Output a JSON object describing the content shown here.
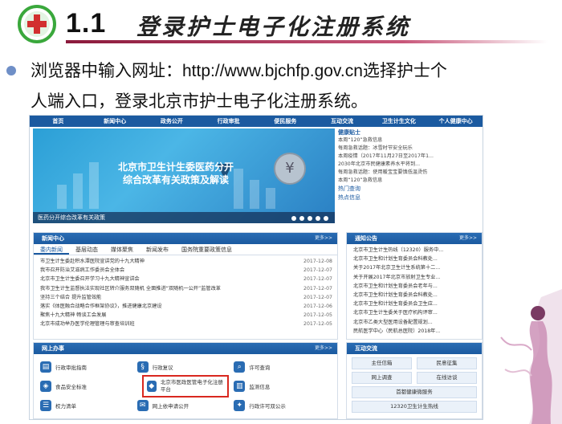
{
  "slide": {
    "title_number": "1.1",
    "title_text": "登录护士电子化注册系统",
    "bullet_line1": "浏览器中输入网址：http://www.bjchfp.gov.cn选择护士个",
    "bullet_line2": "人端入口，登录北京市护士电子化注册系统。"
  },
  "website": {
    "nav": [
      "首页",
      "新闻中心",
      "政务公开",
      "行政审批",
      "便民服务",
      "互动交流",
      "卫生计生文化",
      "个人健康中心"
    ],
    "banner": {
      "headline_line1": "北京市卫生计生委医药分开",
      "headline_line2": "综合改革有关政策及解读",
      "caption": "医药分开综合改革有关政策"
    },
    "health": {
      "title": "健康贴士",
      "items": [
        "本周“120”急救信息",
        "每周急救话题：冰雪时节安全玩乐",
        "本周疫情（2017年11月27日至2017年1...",
        "2030年北京市民健康素养水平将到...",
        "每周急救话题：使用暖宝宝要慎低温烫伤",
        "本周“120”急救信息"
      ],
      "hot_query": "热门查询",
      "hot_info": "热点信息"
    },
    "news": {
      "title": "新闻中心",
      "more": "更多>>",
      "tabs": [
        "委内新闻",
        "基层动态",
        "媒体聚焦",
        "新闻发布",
        "国务院重要政策信息"
      ],
      "rows": [
        {
          "t": "市卫生计生委赴积水潭医院宣讲党的十九大精神",
          "d": "2017-12-08"
        },
        {
          "t": "我市召开防治艾滋病工作委员会全体会",
          "d": "2017-12-07"
        },
        {
          "t": "北京市卫生计生委召开学习十九大精神宣讲会",
          "d": "2017-12-07"
        },
        {
          "t": "我市卫生计生监督执法实现社区转介服务双随机 全面推进“双随机一公开”监管改革",
          "d": "2017-12-07"
        },
        {
          "t": "坚持三个结合 提升监管效能",
          "d": "2017-12-07"
        },
        {
          "t": "落实《体医融合战略合作框架协议》，推进健康北京建设",
          "d": "2017-12-06"
        },
        {
          "t": "聚焦十九大精神 畅谈工会发展",
          "d": "2017-12-05"
        },
        {
          "t": "北京市成功举办医学伦理管理与审查培训班",
          "d": "2017-12-05"
        }
      ]
    },
    "notice": {
      "title": "通知公告",
      "more": "更多>>",
      "rows": [
        "北京市卫生计生热线（12320）服务中...",
        "北京市卫生和计划生育委员会科教处...",
        "关于2017年北京卫生计生系统第十二...",
        "关于开展2017年北京市放射卫生专业...",
        "北京市卫生和计划生育委员会老年与...",
        "北京市卫生和计划生育委员会科教处...",
        "北京市卫生和计划生育委员会卫生应...",
        "北京市卫生计生委关于医疗机构评审...",
        "北京市乙类大型医用设备配置规划...",
        "民航医学中心（民航总医院）2018年..."
      ]
    },
    "online": {
      "title": "网上办事",
      "more": "更多>>",
      "services": [
        "行政审批指南",
        "行政复议",
        "许可查询",
        "食品安全标准",
        "北京市医政医管电子化注册平台",
        "监测信息",
        "权力清单",
        "网上依申请公开",
        "行政许可双公示"
      ]
    },
    "interact": {
      "title": "互动交流",
      "items": [
        "主任信箱",
        "民意征集",
        "网上调查",
        "在线访谈",
        "首都健康微服务",
        "12320卫生计生热线"
      ]
    }
  },
  "colors": {
    "nav_blue": "#1b5aa0",
    "highlight_red": "#d9281f",
    "title_bar": "#8b1a3c"
  },
  "icons": [
    "health-cross-logo-icon",
    "bullet-dot-icon",
    "coin-icon",
    "arrow-down-icon"
  ]
}
